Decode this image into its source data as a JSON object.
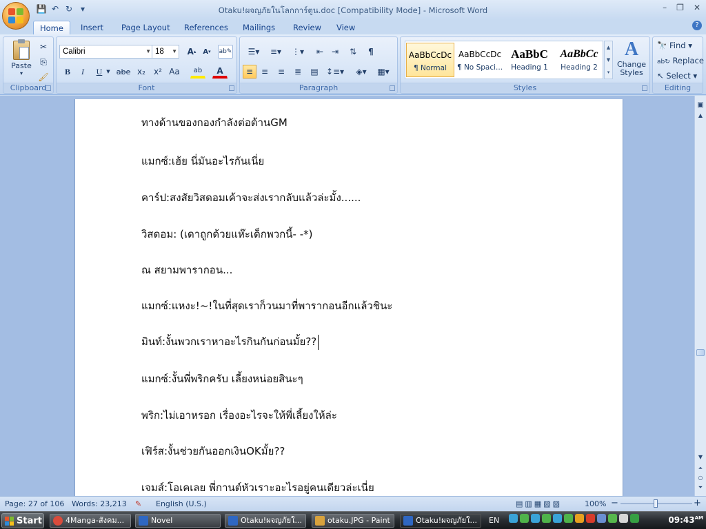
{
  "window": {
    "title": "Otaku!ผจญภัยในโลกการ์ตูน.doc [Compatibility Mode] - Microsoft Word",
    "controls": [
      "–",
      "❐",
      "✕"
    ]
  },
  "quick_access": {
    "save_icon": "💾",
    "undo_icon": "↶",
    "redo_icon": "↻",
    "customize_icon": "▾"
  },
  "tabs": [
    {
      "label": "Home",
      "active": true
    },
    {
      "label": "Insert"
    },
    {
      "label": "Page Layout"
    },
    {
      "label": "References"
    },
    {
      "label": "Mailings"
    },
    {
      "label": "Review"
    },
    {
      "label": "View"
    }
  ],
  "ribbon": {
    "clipboard": {
      "label": "Clipboard",
      "paste": "Paste",
      "paste_arrow": "▾"
    },
    "font": {
      "label": "Font",
      "name": "Calibri",
      "size": "18",
      "grow": "A",
      "shrink": "A",
      "bold": "B",
      "italic": "I",
      "underline": "U",
      "strike": "abe",
      "subscript": "x₂",
      "superscript": "x²",
      "change_case": "Aa",
      "highlight": "ab",
      "font_color": "A"
    },
    "paragraph": {
      "label": "Paragraph"
    },
    "styles": {
      "label": "Styles",
      "items": [
        {
          "preview": "AaBbCcDc",
          "name": "¶ Normal",
          "selected": true
        },
        {
          "preview": "AaBbCcDc",
          "name": "¶ No Spaci..."
        },
        {
          "preview": "AaBbC",
          "name": "Heading 1"
        },
        {
          "preview": "AaBbCc",
          "name": "Heading 2"
        }
      ],
      "change_styles": "Change Styles"
    },
    "editing": {
      "label": "Editing",
      "find": "Find",
      "replace": "Replace",
      "select": "Select"
    }
  },
  "document": {
    "paragraphs": [
      "ทางด้านของกองกำลังต่อต้านGM",
      "แมกซ์:เฮ้ย นี่มันอะไรกันเนี่ย",
      "คาร์ป:สงสัยวิสดอมเค้าจะส่งเรากลับแล้วล่ะมั้ง......",
      "วิสดอม: (เดาถูกด้วยแห๊ะเด็กพวกนี้- -*)",
      "ณ สยามพารากอน...",
      "แมกซ์:แหงะ!~!ในที่สุดเราก็วนมาที่พารากอนอีกแล้วชินะ",
      "มินท์:งั้นพวกเราหาอะไรกินกันก่อนมั้ย??",
      "แมกซ์:งั้นพี่พริกครับ เลี้ยงหน่อยสินะๆ",
      "พริก:ไม่เอาหรอก เรื่องอะไรจะให้พี่เลี้ยงให้ล่ะ",
      "เฟิร์ส:งั้นช่วยกันออกเงินOKมั้ย??",
      "เจมส์:โอเคเลย พี่กานต์หัวเราะอะไรอยู่คนเดียวล่ะเนี่ย"
    ]
  },
  "status": {
    "page": "Page: 27 of 106",
    "words": "Words: 23,213",
    "language": "English (U.S.)",
    "zoom": "100%",
    "zoom_minus": "−",
    "zoom_plus": "+"
  },
  "taskbar": {
    "start": "Start",
    "items": [
      {
        "label": "4Manga-สังคม...",
        "color": "#d94b3c"
      },
      {
        "label": "Novel",
        "color": "#e8c14c"
      },
      {
        "label": "Otaku!ผจญภัยใ...",
        "color": "#2f67c2"
      },
      {
        "label": "otaku.JPG - Paint",
        "color": "#d8a23d"
      },
      {
        "label": "Otaku!ผจญภัยใ...",
        "color": "#2f67c2",
        "active": true
      }
    ],
    "lang": "EN",
    "clock": "09:43",
    "clock_suffix": "AM"
  }
}
